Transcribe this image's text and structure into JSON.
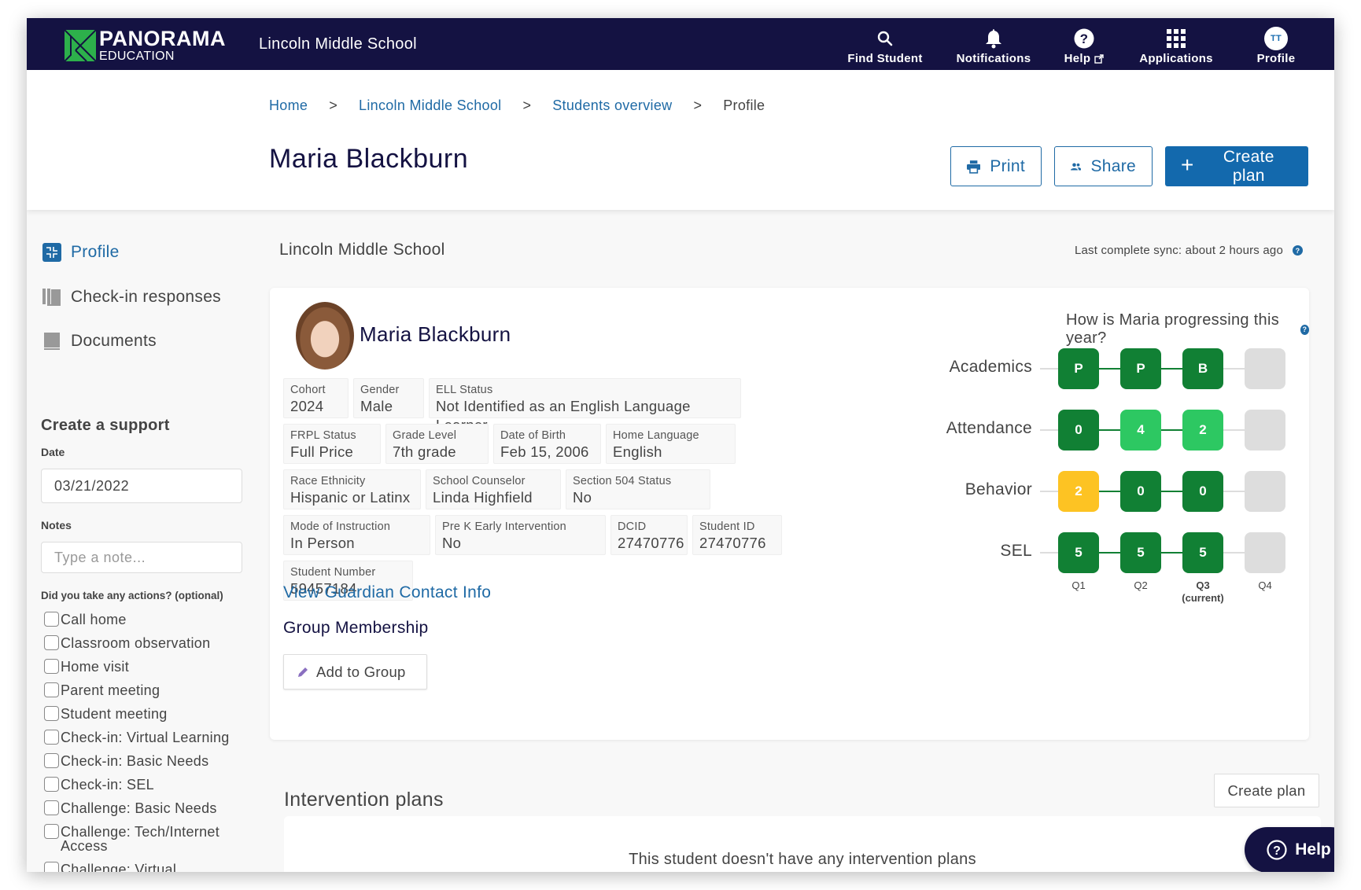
{
  "navbar": {
    "logo_title": "PANORAMA",
    "logo_subtitle": "EDUCATION",
    "school": "Lincoln Middle School",
    "items": [
      {
        "label": "Find Student",
        "icon": "search-icon"
      },
      {
        "label": "Notifications",
        "icon": "bell-icon"
      },
      {
        "label": "Help",
        "icon": "help-circle-icon"
      },
      {
        "label": "Applications",
        "icon": "grid-icon"
      },
      {
        "label": "Profile",
        "icon": "avatar",
        "initials": "TT"
      }
    ]
  },
  "breadcrumb": {
    "items": [
      "Home",
      "Lincoln Middle School",
      "Students overview"
    ],
    "current": "Profile",
    "separator": ">"
  },
  "header": {
    "title": "Maria Blackburn",
    "print_label": "Print",
    "share_label": "Share",
    "create_plan_label": "Create plan"
  },
  "sidebar": {
    "nav": [
      {
        "label": "Profile",
        "icon": "puzzle-icon",
        "active": true
      },
      {
        "label": "Check-in responses",
        "icon": "books-icon",
        "active": false
      },
      {
        "label": "Documents",
        "icon": "book-icon",
        "active": false
      }
    ],
    "support": {
      "title": "Create a support",
      "date_label": "Date",
      "date_value": "03/21/2022",
      "notes_label": "Notes",
      "notes_placeholder": "Type a note...",
      "actions_label": "Did you take any actions? (optional)",
      "actions": [
        "Call home",
        "Classroom observation",
        "Home visit",
        "Parent meeting",
        "Student meeting",
        "Check-in: Virtual Learning",
        "Check-in: Basic Needs",
        "Check-in: SEL",
        "Challenge: Basic Needs",
        "Challenge: Tech/Internet Access",
        "Challenge: Virtual"
      ]
    }
  },
  "main": {
    "school_label": "Lincoln Middle School",
    "sync_text": "Last complete sync: about 2 hours ago",
    "student": {
      "name": "Maria Blackburn",
      "attributes": [
        [
          {
            "label": "Cohort",
            "value": "2024"
          },
          {
            "label": "Gender",
            "value": "Male"
          },
          {
            "label": "ELL Status",
            "value": "Not Identified as an English Language Learner"
          }
        ],
        [
          {
            "label": "FRPL Status",
            "value": "Full Price"
          },
          {
            "label": "Grade Level",
            "value": "7th grade"
          },
          {
            "label": "Date of Birth",
            "value": "Feb 15, 2006"
          },
          {
            "label": "Home Language",
            "value": "English"
          }
        ],
        [
          {
            "label": "Race Ethnicity",
            "value": "Hispanic or Latinx"
          },
          {
            "label": "School Counselor",
            "value": "Linda Highfield"
          },
          {
            "label": "Section 504 Status",
            "value": "No"
          }
        ],
        [
          {
            "label": "Mode of Instruction",
            "value": "In Person"
          },
          {
            "label": "Pre K Early Intervention",
            "value": "No"
          },
          {
            "label": "DCID",
            "value": "27470776"
          },
          {
            "label": "Student ID",
            "value": "27470776"
          }
        ],
        [
          {
            "label": "Student Number",
            "value": "59457184"
          }
        ]
      ],
      "guardian_link": "View Guardian Contact Info",
      "group_title": "Group Membership",
      "add_group_label": "Add to Group"
    },
    "progress": {
      "question": "How is Maria progressing this year?",
      "quarters": [
        "Q1",
        "Q2",
        "Q3",
        "Q4"
      ],
      "current_quarter_note": "(current)",
      "current_index": 2,
      "rows": [
        {
          "label": "Academics",
          "cells": [
            {
              "value": "P",
              "status": "green"
            },
            {
              "value": "P",
              "status": "green"
            },
            {
              "value": "B",
              "status": "green"
            },
            {
              "value": "",
              "status": "empty"
            }
          ]
        },
        {
          "label": "Attendance",
          "cells": [
            {
              "value": "0",
              "status": "green"
            },
            {
              "value": "4",
              "status": "light-green"
            },
            {
              "value": "2",
              "status": "light-green"
            },
            {
              "value": "",
              "status": "empty"
            }
          ]
        },
        {
          "label": "Behavior",
          "cells": [
            {
              "value": "2",
              "status": "yellow"
            },
            {
              "value": "0",
              "status": "green"
            },
            {
              "value": "0",
              "status": "green"
            },
            {
              "value": "",
              "status": "empty"
            }
          ]
        },
        {
          "label": "SEL",
          "cells": [
            {
              "value": "5",
              "status": "green"
            },
            {
              "value": "5",
              "status": "green"
            },
            {
              "value": "5",
              "status": "green"
            },
            {
              "value": "",
              "status": "empty"
            }
          ]
        }
      ],
      "colors": {
        "green": "#118034",
        "light-green": "#2dc862",
        "yellow": "#fdc323",
        "empty": "#dddddd"
      }
    },
    "interventions": {
      "title": "Intervention plans",
      "create_label": "Create plan",
      "empty_text": "This student doesn't have any intervention plans"
    }
  },
  "help_button": {
    "label": "Help"
  },
  "colors": {
    "navy": "#141242",
    "brand_blue": "#1369ad",
    "link_blue": "#1f6aa5",
    "logo_green": "#2db04b"
  }
}
